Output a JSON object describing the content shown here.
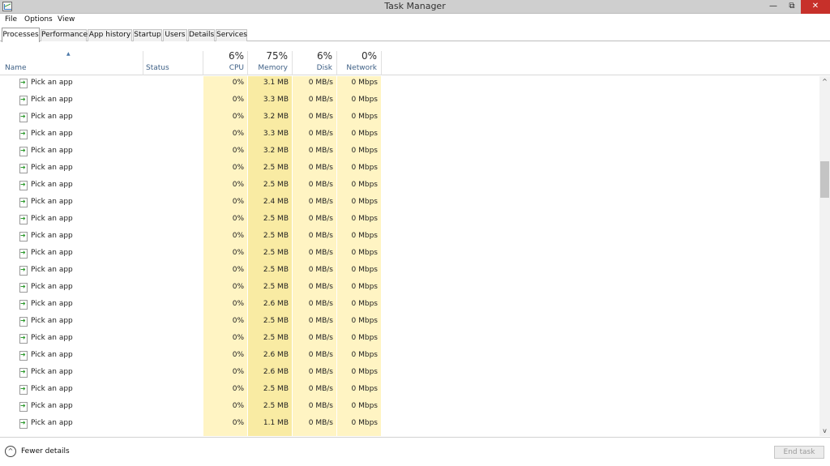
{
  "window": {
    "title": "Task Manager",
    "minimize_glyph": "—",
    "maximize_glyph": "⧉",
    "close_glyph": "✕"
  },
  "menu": {
    "items": [
      "File",
      "Options",
      "View"
    ]
  },
  "tabs": [
    "Processes",
    "Performance",
    "App history",
    "Startup",
    "Users",
    "Details",
    "Services"
  ],
  "active_tab": "Processes",
  "columns": {
    "name": "Name",
    "status": "Status",
    "cpu": {
      "pct": "6%",
      "label": "CPU"
    },
    "memory": {
      "pct": "75%",
      "label": "Memory"
    },
    "disk": {
      "pct": "6%",
      "label": "Disk"
    },
    "network": {
      "pct": "0%",
      "label": "Network"
    }
  },
  "sort_glyph": "▲",
  "rows": [
    {
      "name": "Pick an app",
      "cpu": "0%",
      "memory": "3.1 MB",
      "disk": "0 MB/s",
      "network": "0 Mbps"
    },
    {
      "name": "Pick an app",
      "cpu": "0%",
      "memory": "3.3 MB",
      "disk": "0 MB/s",
      "network": "0 Mbps"
    },
    {
      "name": "Pick an app",
      "cpu": "0%",
      "memory": "3.2 MB",
      "disk": "0 MB/s",
      "network": "0 Mbps"
    },
    {
      "name": "Pick an app",
      "cpu": "0%",
      "memory": "3.3 MB",
      "disk": "0 MB/s",
      "network": "0 Mbps"
    },
    {
      "name": "Pick an app",
      "cpu": "0%",
      "memory": "3.2 MB",
      "disk": "0 MB/s",
      "network": "0 Mbps"
    },
    {
      "name": "Pick an app",
      "cpu": "0%",
      "memory": "2.5 MB",
      "disk": "0 MB/s",
      "network": "0 Mbps"
    },
    {
      "name": "Pick an app",
      "cpu": "0%",
      "memory": "2.5 MB",
      "disk": "0 MB/s",
      "network": "0 Mbps"
    },
    {
      "name": "Pick an app",
      "cpu": "0%",
      "memory": "2.4 MB",
      "disk": "0 MB/s",
      "network": "0 Mbps"
    },
    {
      "name": "Pick an app",
      "cpu": "0%",
      "memory": "2.5 MB",
      "disk": "0 MB/s",
      "network": "0 Mbps"
    },
    {
      "name": "Pick an app",
      "cpu": "0%",
      "memory": "2.5 MB",
      "disk": "0 MB/s",
      "network": "0 Mbps"
    },
    {
      "name": "Pick an app",
      "cpu": "0%",
      "memory": "2.5 MB",
      "disk": "0 MB/s",
      "network": "0 Mbps"
    },
    {
      "name": "Pick an app",
      "cpu": "0%",
      "memory": "2.5 MB",
      "disk": "0 MB/s",
      "network": "0 Mbps"
    },
    {
      "name": "Pick an app",
      "cpu": "0%",
      "memory": "2.5 MB",
      "disk": "0 MB/s",
      "network": "0 Mbps"
    },
    {
      "name": "Pick an app",
      "cpu": "0%",
      "memory": "2.6 MB",
      "disk": "0 MB/s",
      "network": "0 Mbps"
    },
    {
      "name": "Pick an app",
      "cpu": "0%",
      "memory": "2.5 MB",
      "disk": "0 MB/s",
      "network": "0 Mbps"
    },
    {
      "name": "Pick an app",
      "cpu": "0%",
      "memory": "2.5 MB",
      "disk": "0 MB/s",
      "network": "0 Mbps"
    },
    {
      "name": "Pick an app",
      "cpu": "0%",
      "memory": "2.6 MB",
      "disk": "0 MB/s",
      "network": "0 Mbps"
    },
    {
      "name": "Pick an app",
      "cpu": "0%",
      "memory": "2.6 MB",
      "disk": "0 MB/s",
      "network": "0 Mbps"
    },
    {
      "name": "Pick an app",
      "cpu": "0%",
      "memory": "2.5 MB",
      "disk": "0 MB/s",
      "network": "0 Mbps"
    },
    {
      "name": "Pick an app",
      "cpu": "0%",
      "memory": "2.5 MB",
      "disk": "0 MB/s",
      "network": "0 Mbps"
    },
    {
      "name": "Pick an app",
      "cpu": "0%",
      "memory": "1.1 MB",
      "disk": "0 MB/s",
      "network": "0 Mbps"
    }
  ],
  "footer": {
    "fewer_details": "Fewer details",
    "fewer_icon_glyph": "^",
    "end_task": "End task"
  },
  "scrollbar": {
    "up_glyph": "^",
    "down_glyph": "v"
  },
  "colors": {
    "heat_light": "#fff4c3",
    "heat_memory": "#f9eba3",
    "close_button": "#c7302a",
    "header_label": "#3d5f85"
  },
  "icons": {
    "app_icon": "task-manager-icon",
    "row_icon": "app-window-icon"
  }
}
